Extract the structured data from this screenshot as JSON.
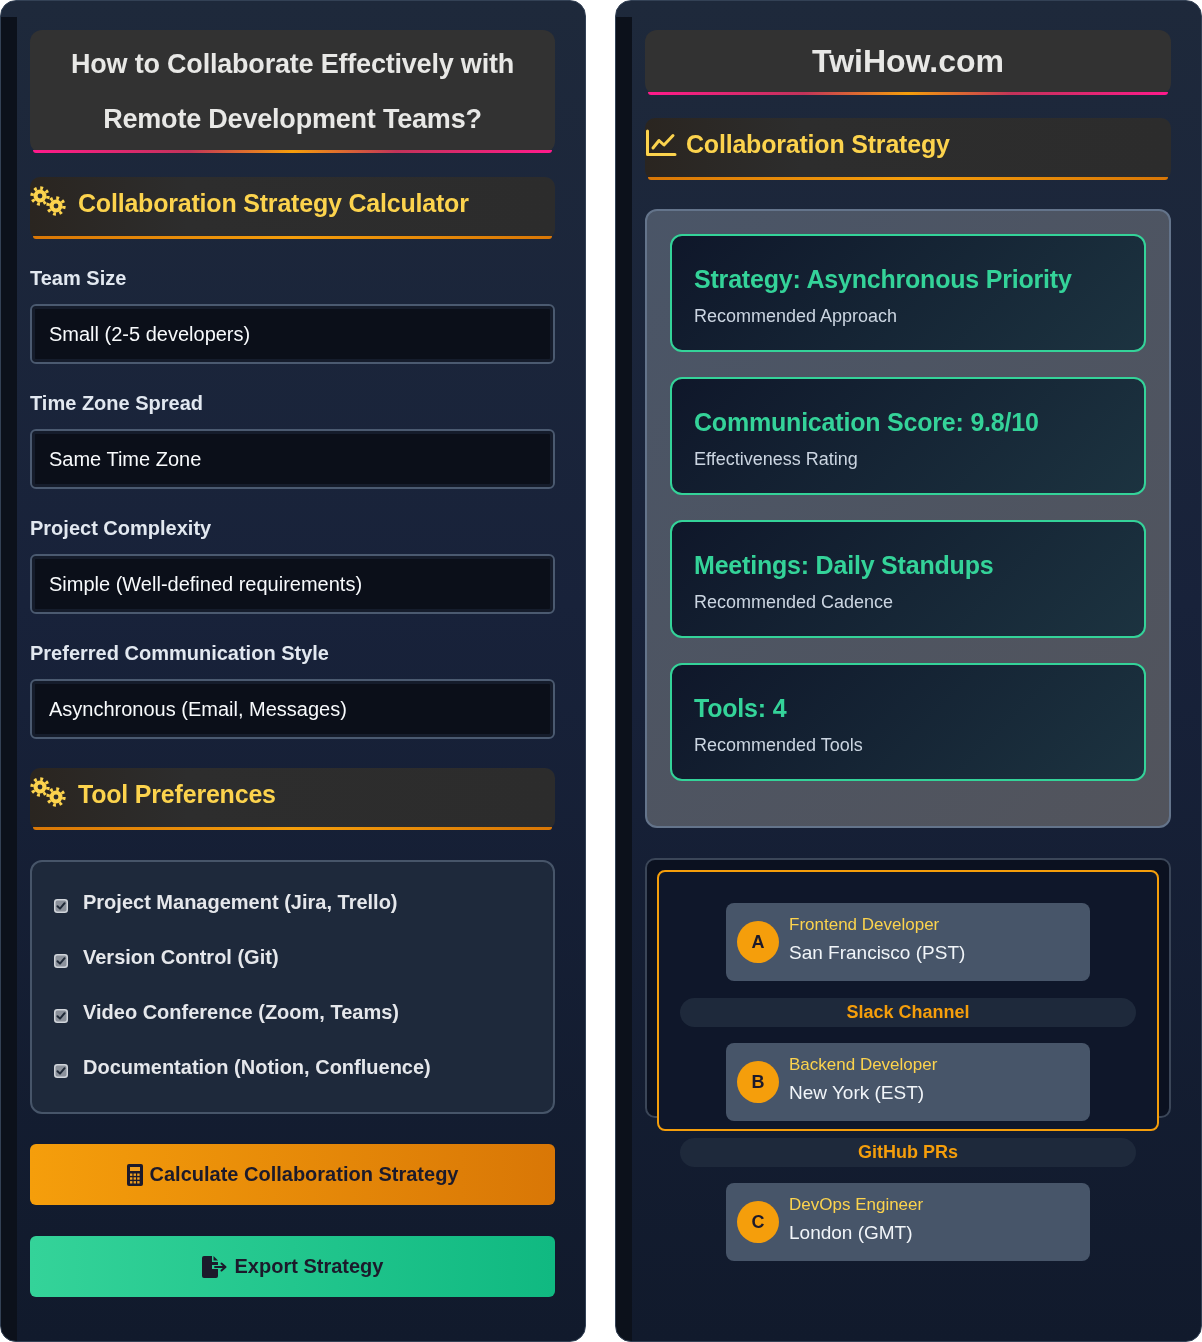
{
  "left_panel": {
    "title": "How to Collaborate Effectively with Remote Development Teams?",
    "calculator": {
      "heading": "Collaboration Strategy Calculator",
      "fields": [
        {
          "label": "Team Size",
          "value": "Small (2-5 developers)"
        },
        {
          "label": "Time Zone Spread",
          "value": "Same Time Zone"
        },
        {
          "label": "Project Complexity",
          "value": "Simple (Well-defined requirements)"
        },
        {
          "label": "Preferred Communication Style",
          "value": "Asynchronous (Email, Messages)"
        }
      ]
    },
    "tool_preferences": {
      "heading": "Tool Preferences",
      "items": [
        {
          "label": "Project Management (Jira, Trello)",
          "checked": true
        },
        {
          "label": "Version Control (Git)",
          "checked": true
        },
        {
          "label": "Video Conference (Zoom, Teams)",
          "checked": true
        },
        {
          "label": "Documentation (Notion, Confluence)",
          "checked": true
        }
      ]
    },
    "buttons": [
      {
        "kind": "calculate",
        "label": "Calculate Collaboration Strategy"
      },
      {
        "kind": "export",
        "label": "Export Strategy"
      }
    ]
  },
  "right_panel": {
    "site_title": "TwiHow.com",
    "heading": "Collaboration Strategy",
    "results": [
      {
        "title": "Strategy: Asynchronous Priority",
        "caption": "Recommended Approach"
      },
      {
        "title": "Communication Score: 9.8/10",
        "caption": "Effectiveness Rating"
      },
      {
        "title": "Meetings: Daily Standups",
        "caption": "Recommended Cadence"
      },
      {
        "title": "Tools: 4",
        "caption": "Recommended Tools"
      }
    ],
    "team_diagram": [
      {
        "kind": "member",
        "badge": "A",
        "role": "Frontend Developer",
        "location": "San Francisco (PST)"
      },
      {
        "kind": "channel",
        "label": "Slack Channel"
      },
      {
        "kind": "member",
        "badge": "B",
        "role": "Backend Developer",
        "location": "New York (EST)"
      },
      {
        "kind": "channel",
        "label": "GitHub PRs"
      },
      {
        "kind": "member",
        "badge": "C",
        "role": "DevOps Engineer",
        "location": "London (GMT)"
      }
    ]
  }
}
